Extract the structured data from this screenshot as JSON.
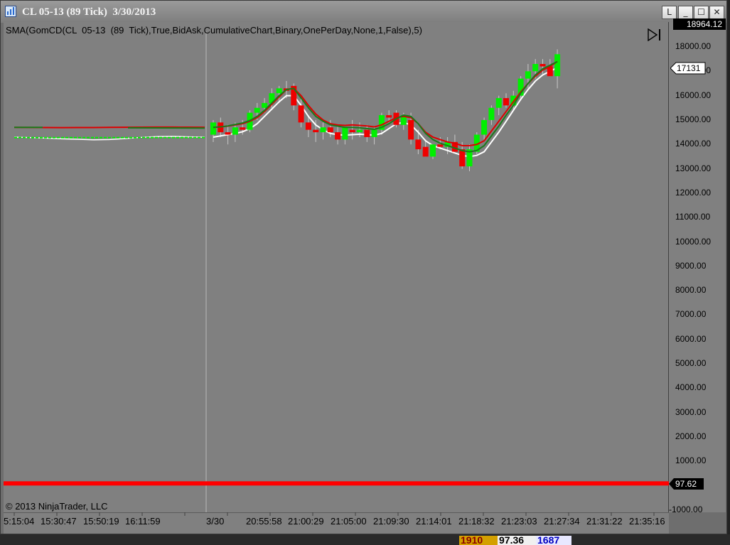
{
  "window": {
    "title": "CL 05-13 (89 Tick)  3/30/2013",
    "buttons": [
      "L",
      "_",
      "☐",
      "✕"
    ]
  },
  "indicator_label": "SMA(GomCD(CL  05-13  (89  Tick),True,BidAsk,CumulativeChart,Binary,OnePerDay,None,1,False),5)",
  "copyright": "© 2013 NinjaTrader, LLC",
  "colors": {
    "up": "#00f000",
    "down": "#ee0000",
    "sma_red": "#dd0000",
    "sma_green": "#1a7a1a",
    "sma_white": "#ffffff",
    "wick": "#c8c8c8"
  },
  "chart_data": {
    "type": "candlestick",
    "title": "",
    "y_axis": {
      "range": [
        -1000,
        18964.12
      ],
      "ticks": [
        "18000.00",
        "17000.00",
        "16000.00",
        "15000.00",
        "14000.00",
        "13000.00",
        "12000.00",
        "11000.00",
        "10000.00",
        "9000.00",
        "8000.00",
        "7000.00",
        "6000.00",
        "5000.00",
        "4000.00",
        "3000.00",
        "2000.00",
        "1000.00",
        "-1000.00"
      ],
      "tick_values": [
        18000,
        17000,
        16000,
        15000,
        14000,
        13000,
        12000,
        11000,
        10000,
        9000,
        8000,
        7000,
        6000,
        5000,
        4000,
        3000,
        2000,
        1000,
        -1000
      ],
      "max_label": "18964.12"
    },
    "x_axis": {
      "ticks": [
        "5:15:04",
        "15:30:47",
        "15:50:19",
        "16:11:59",
        "3/30",
        "20:55:58",
        "21:00:29",
        "21:05:00",
        "21:09:30",
        "21:14:01",
        "21:18:32",
        "21:23:03",
        "21:27:34",
        "21:31:22",
        "21:35:16"
      ]
    },
    "session_break_label": "3/30",
    "flags": {
      "last_value": "17131",
      "price_level": "97.62",
      "price_value": 97.62
    },
    "flat_series": {
      "from_index": 0,
      "to_index": 46,
      "values": [
        14300,
        14280,
        14260,
        14230,
        14210,
        14190,
        14200,
        14240,
        14290,
        14320,
        14330,
        14310,
        14300
      ],
      "sma_red": 14700,
      "sma_green": 14700
    },
    "candles": [
      {
        "o": 14400,
        "h": 15000,
        "l": 14100,
        "c": 14900
      },
      {
        "o": 14900,
        "h": 15100,
        "l": 14300,
        "c": 14500
      },
      {
        "o": 14500,
        "h": 14800,
        "l": 14000,
        "c": 14400
      },
      {
        "o": 14400,
        "h": 14900,
        "l": 14100,
        "c": 14700
      },
      {
        "o": 14700,
        "h": 15000,
        "l": 14400,
        "c": 14600
      },
      {
        "o": 14600,
        "h": 15400,
        "l": 14500,
        "c": 15300
      },
      {
        "o": 15300,
        "h": 15700,
        "l": 15000,
        "c": 15500
      },
      {
        "o": 15500,
        "h": 15900,
        "l": 15300,
        "c": 15700
      },
      {
        "o": 15700,
        "h": 16300,
        "l": 15500,
        "c": 16100
      },
      {
        "o": 16100,
        "h": 16400,
        "l": 15700,
        "c": 16300
      },
      {
        "o": 16300,
        "h": 16600,
        "l": 15900,
        "c": 16200
      },
      {
        "o": 16400,
        "h": 16500,
        "l": 15400,
        "c": 15600
      },
      {
        "o": 15600,
        "h": 15900,
        "l": 14700,
        "c": 14900
      },
      {
        "o": 14900,
        "h": 15200,
        "l": 14300,
        "c": 14600
      },
      {
        "o": 14600,
        "h": 15000,
        "l": 14100,
        "c": 14500
      },
      {
        "o": 14500,
        "h": 14900,
        "l": 14200,
        "c": 14700
      },
      {
        "o": 14700,
        "h": 15000,
        "l": 14300,
        "c": 14500
      },
      {
        "o": 14500,
        "h": 14800,
        "l": 14000,
        "c": 14200
      },
      {
        "o": 14200,
        "h": 14700,
        "l": 14000,
        "c": 14700
      },
      {
        "o": 14600,
        "h": 15000,
        "l": 14200,
        "c": 14500
      },
      {
        "o": 14500,
        "h": 14900,
        "l": 14300,
        "c": 14600
      },
      {
        "o": 14600,
        "h": 14800,
        "l": 14100,
        "c": 14300
      },
      {
        "o": 14300,
        "h": 14700,
        "l": 14000,
        "c": 14600
      },
      {
        "o": 14600,
        "h": 15300,
        "l": 14400,
        "c": 15200
      },
      {
        "o": 15200,
        "h": 15400,
        "l": 14900,
        "c": 15100
      },
      {
        "o": 15300,
        "h": 15400,
        "l": 14700,
        "c": 14800
      },
      {
        "o": 14800,
        "h": 15300,
        "l": 14600,
        "c": 15200
      },
      {
        "o": 15000,
        "h": 15300,
        "l": 14000,
        "c": 14200
      },
      {
        "o": 14200,
        "h": 14600,
        "l": 13600,
        "c": 13800
      },
      {
        "o": 13900,
        "h": 14200,
        "l": 13500,
        "c": 13500
      },
      {
        "o": 13500,
        "h": 14000,
        "l": 13400,
        "c": 14000
      },
      {
        "o": 14000,
        "h": 14300,
        "l": 13800,
        "c": 13900
      },
      {
        "o": 13900,
        "h": 14300,
        "l": 13600,
        "c": 14100
      },
      {
        "o": 14100,
        "h": 14400,
        "l": 13700,
        "c": 13700
      },
      {
        "o": 13800,
        "h": 14100,
        "l": 13000,
        "c": 13100
      },
      {
        "o": 13100,
        "h": 14000,
        "l": 12900,
        "c": 13800
      },
      {
        "o": 13700,
        "h": 14500,
        "l": 13600,
        "c": 14400
      },
      {
        "o": 14400,
        "h": 15100,
        "l": 14200,
        "c": 15000
      },
      {
        "o": 15000,
        "h": 15600,
        "l": 14800,
        "c": 15500
      },
      {
        "o": 15500,
        "h": 16000,
        "l": 15200,
        "c": 15900
      },
      {
        "o": 15900,
        "h": 16100,
        "l": 15500,
        "c": 15600
      },
      {
        "o": 15600,
        "h": 16200,
        "l": 15400,
        "c": 16000
      },
      {
        "o": 16000,
        "h": 16800,
        "l": 15800,
        "c": 16700
      },
      {
        "o": 16700,
        "h": 17300,
        "l": 16300,
        "c": 17000
      },
      {
        "o": 17000,
        "h": 17500,
        "l": 16700,
        "c": 17300
      },
      {
        "o": 17300,
        "h": 17500,
        "l": 16900,
        "c": 17200
      },
      {
        "o": 17200,
        "h": 17500,
        "l": 16800,
        "c": 16800
      },
      {
        "o": 16800,
        "h": 17900,
        "l": 16300,
        "c": 17700
      }
    ],
    "sma_red_series": [
      14700,
      14720,
      14750,
      14800,
      14850,
      14950,
      15100,
      15350,
      15650,
      15950,
      16250,
      16300,
      16000,
      15600,
      15250,
      15000,
      14850,
      14800,
      14780,
      14800,
      14780,
      14760,
      14720,
      14800,
      14950,
      15100,
      15150,
      15100,
      14850,
      14500,
      14300,
      14200,
      14100,
      14050,
      13950,
      13950,
      14000,
      14150,
      14550,
      14950,
      15350,
      15750,
      16150,
      16500,
      16800,
      17050,
      17200,
      17400
    ],
    "sma_green_series": [
      14700,
      14720,
      14760,
      14820,
      14880,
      14980,
      15150,
      15400,
      15700,
      16000,
      16250,
      16300,
      15900,
      15500,
      15150,
      14950,
      14800,
      14750,
      14700,
      14700,
      14680,
      14650,
      14620,
      14700,
      14850,
      15050,
      15200,
      15150,
      14850,
      14450,
      14200,
      14050,
      13950,
      13850,
      13750,
      13700,
      13750,
      13950,
      14350,
      14750,
      15200,
      15600,
      16100,
      16500,
      16850,
      17100,
      17250,
      17400
    ],
    "sma_white_series": [
      14300,
      14350,
      14400,
      14450,
      14520,
      14650,
      14850,
      15150,
      15450,
      15750,
      16000,
      16000,
      15600,
      15150,
      14800,
      14600,
      14450,
      14400,
      14380,
      14400,
      14420,
      14400,
      14380,
      14450,
      14650,
      14850,
      14900,
      14800,
      14500,
      14150,
      13950,
      13850,
      13750,
      13650,
      13550,
      13500,
      13550,
      13700,
      14100,
      14500,
      14950,
      15400,
      15850,
      16250,
      16600,
      16850,
      17000,
      17150
    ]
  },
  "bottom_bar": {
    "value1": "1910",
    "value2": "97.36",
    "value3": "1687"
  }
}
